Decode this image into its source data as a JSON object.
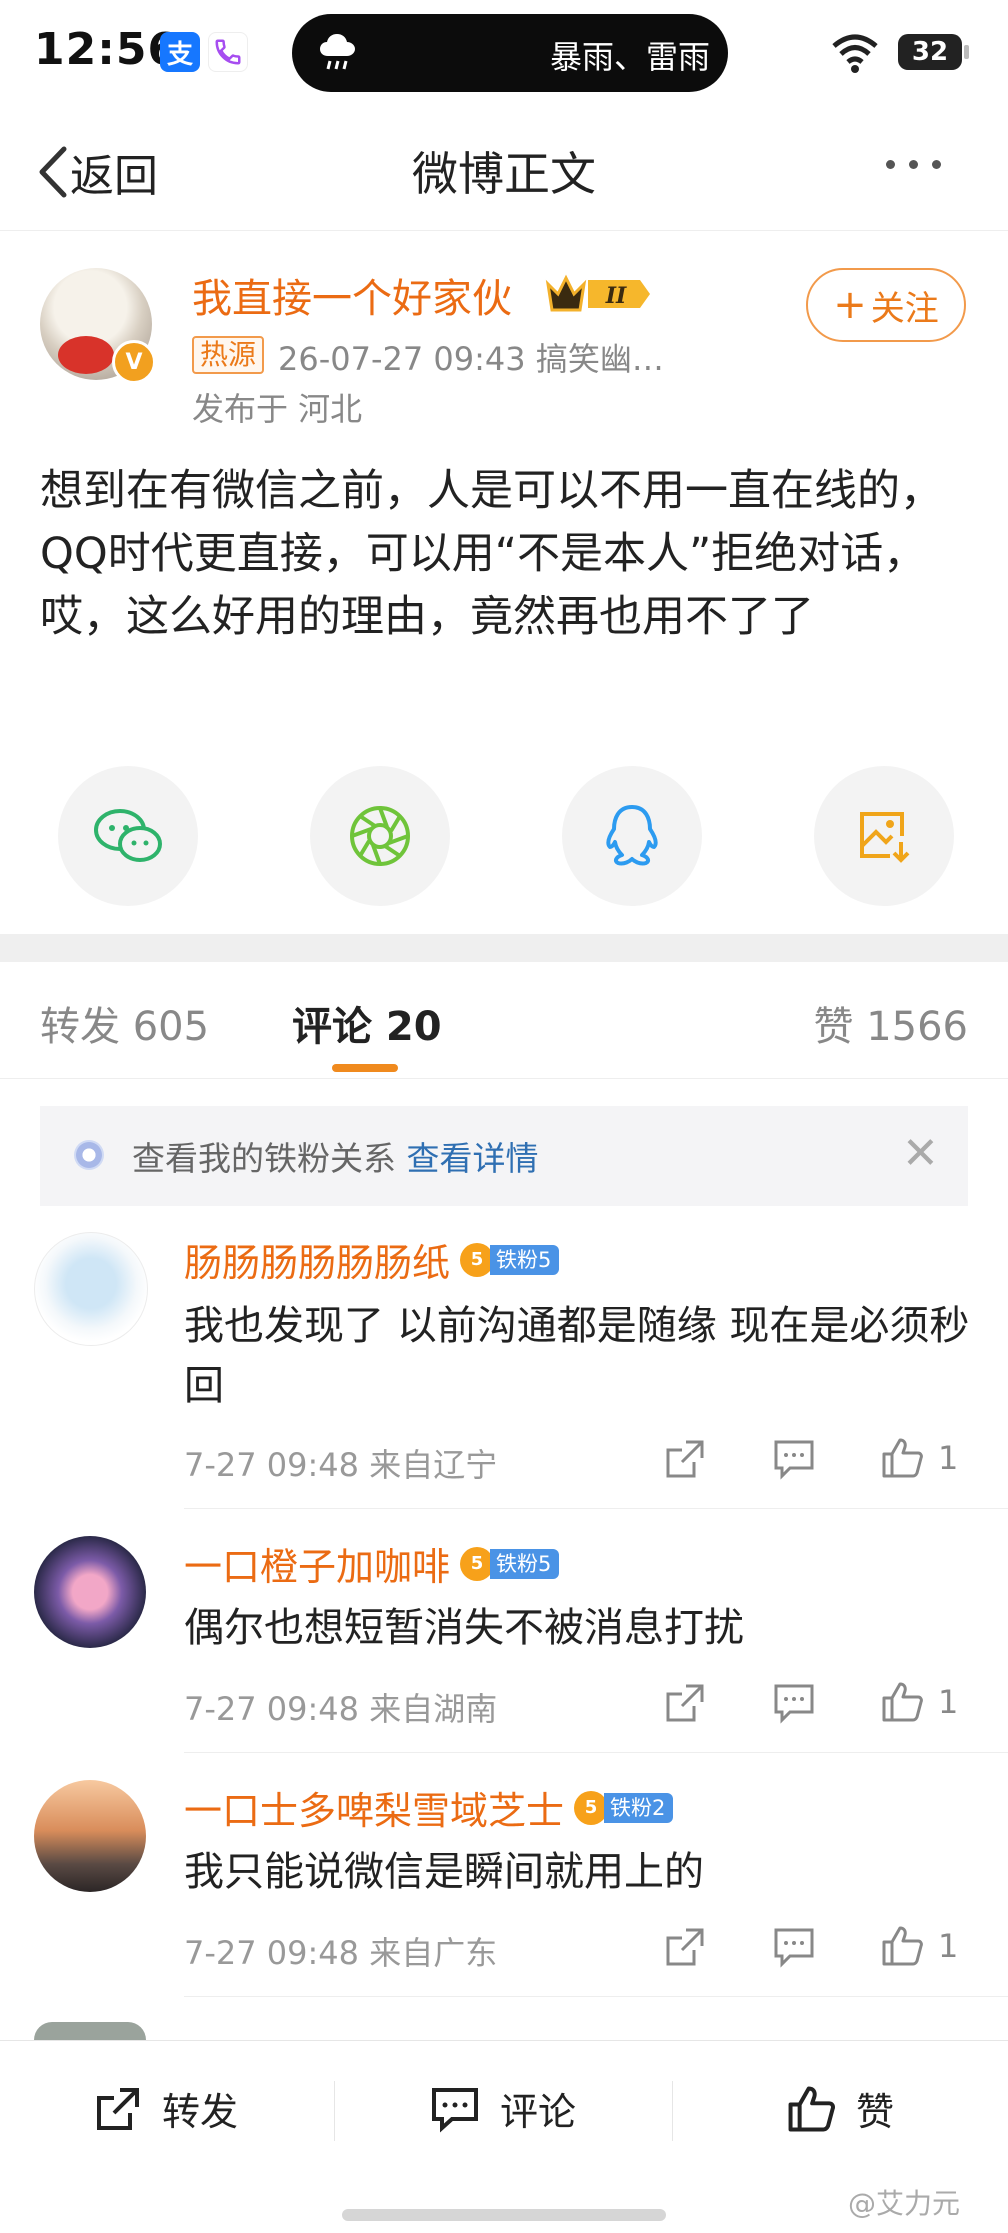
{
  "status_bar": {
    "time": "12:56",
    "alipay_icon_text": "支",
    "weather_text": "暴雨、雷雨",
    "battery": "32"
  },
  "nav": {
    "back_label": "返回",
    "title": "微博正文"
  },
  "post": {
    "username": "我直接一个好家伙",
    "vip_level": "II",
    "verified_mark": "V",
    "hot_badge": "热源",
    "meta": "26-07-27 09:43  搞笑幽…",
    "location": "发布于 河北",
    "follow_label": "关注",
    "body": "想到在有微信之前，人是可以不用一直在线的，QQ时代更直接，可以用“不是本人”拒绝对话，哎，这么好用的理由，竟然再也用不了了"
  },
  "share_icons": [
    "wechat-icon",
    "moments-icon",
    "qq-icon",
    "save-image-icon"
  ],
  "tabs": {
    "repost": "转发 605",
    "comment": "评论 20",
    "like": "赞 1566"
  },
  "fan_banner": {
    "text": "查看我的铁粉关系",
    "link": "查看详情"
  },
  "comments": [
    {
      "name": "肠肠肠肠肠肠纸",
      "badge_level": "5",
      "badge": "铁粉5",
      "text": "我也发现了 以前沟通都是随缘 现在是必须秒回",
      "meta": "7-27 09:48 来自辽宁",
      "likes": "1"
    },
    {
      "name": "一口橙子加咖啡",
      "badge_level": "5",
      "badge": "铁粉5",
      "text": "偶尔也想短暂消失不被消息打扰",
      "meta": "7-27 09:48 来自湖南",
      "likes": "1"
    },
    {
      "name": "一口士多啤梨雪域芝士",
      "badge_level": "5",
      "badge": "铁粉2",
      "text": "我只能说微信是瞬间就用上的",
      "meta": "7-27 09:48 来自广东",
      "likes": "1"
    }
  ],
  "bottom_bar": {
    "repost": "转发",
    "comment": "评论",
    "like": "赞"
  },
  "watermark": "@艾力元",
  "colors": {
    "accent_orange": "#eb6b13",
    "link_blue": "#2f6fb2",
    "fan_badge_blue": "#4a93e6"
  }
}
